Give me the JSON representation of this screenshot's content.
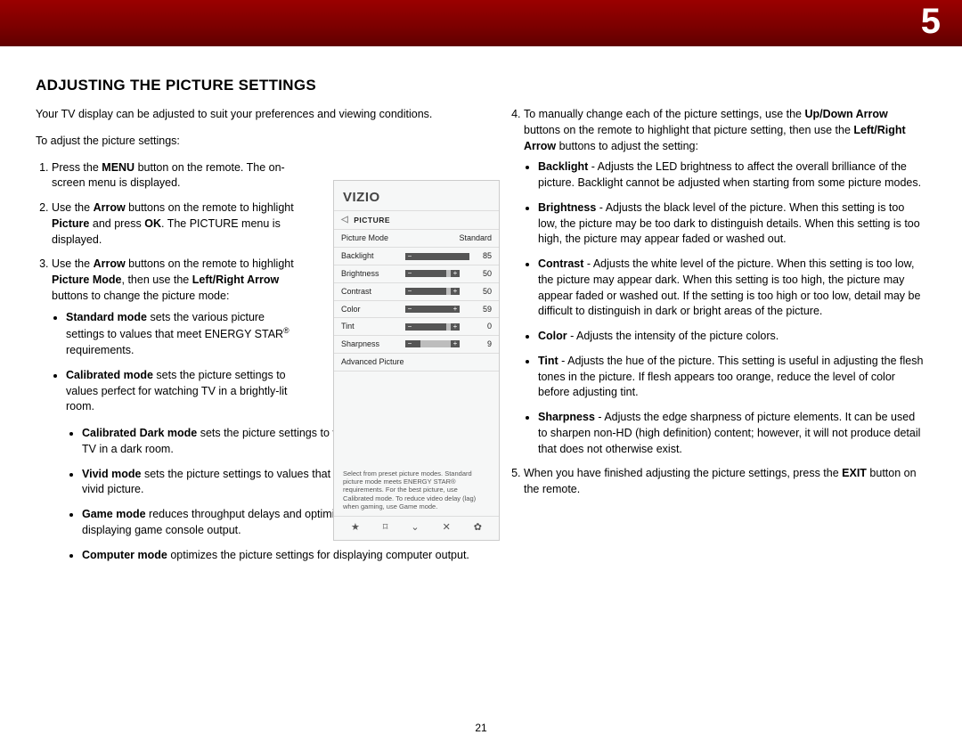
{
  "chapter_number": "5",
  "page_number": "21",
  "heading": "ADJUSTING THE PICTURE SETTINGS",
  "left": {
    "intro": "Your TV display can be adjusted to suit your preferences and viewing conditions.",
    "lead": "To adjust the picture settings:",
    "s1a": "Press the ",
    "s1b": "MENU",
    "s1c": " button on the remote. The on-screen menu is displayed.",
    "s2a": "Use the ",
    "s2b": "Arrow",
    "s2c": " buttons on the remote to highlight ",
    "s2d": "Picture",
    "s2e": " and press ",
    "s2f": "OK",
    "s2g": ". The PICTURE menu is displayed.",
    "s3a": "Use the ",
    "s3b": "Arrow",
    "s3c": " buttons on the remote to highlight ",
    "s3d": "Picture Mode",
    "s3e": ", then use the ",
    "s3f": "Left/Right Arrow",
    "s3g": " buttons to change the picture mode:",
    "m1a": "Standard mode",
    "m1b": " sets the various picture settings to values that meet ENERGY STAR",
    "m1sup": "®",
    "m1c": " requirements.",
    "m2a": "Calibrated mode",
    "m2b": " sets the picture settings to values perfect for watching TV in a brightly-lit room.",
    "m3a": "Calibrated Dark mode",
    "m3b": " sets the picture settings to values perfect for watching TV in a dark room.",
    "m4a": "Vivid mode",
    "m4b": " sets the picture settings to values that produce a brighter, more vivid picture.",
    "m5a": "Game mode",
    "m5b": " reduces throughput delays and optimizes the picture settings for displaying game console output.",
    "m6a": "Computer mode",
    "m6b": " optimizes the picture settings for displaying computer output."
  },
  "right": {
    "s4a": "To manually change each of the picture settings, use the ",
    "s4b": "Up/Down Arrow",
    "s4c": " buttons on the remote to highlight that picture setting, then use the ",
    "s4d": "Left/Right Arrow",
    "s4e": " buttons to adjust the setting:",
    "d1a": "Backlight",
    "d1b": " - Adjusts the LED brightness to affect the overall brilliance of the picture. Backlight cannot be adjusted when starting from some picture modes.",
    "d2a": "Brightness",
    "d2b": " - Adjusts the black level of the picture. When this setting is too low, the picture may be too dark to distinguish details. When this setting is too high, the picture may appear faded or washed out.",
    "d3a": "Contrast",
    "d3b": " - Adjusts the white level of the picture. When this setting is too low, the picture may appear dark. When this setting is too high, the picture may appear faded or washed out. If the setting is too high or too low, detail may be difficult to distinguish in dark or bright areas of the picture.",
    "d4a": "Color",
    "d4b": " - Adjusts the intensity of the picture colors.",
    "d5a": "Tint",
    "d5b": " - Adjusts the hue of the picture. This setting is useful in adjusting the flesh tones in the picture. If flesh appears too orange, reduce the level of color before adjusting tint.",
    "d6a": "Sharpness",
    "d6b": " - Adjusts the edge sharpness of picture elements. It can be used to sharpen non-HD (high definition) content; however, it will not produce detail that does not otherwise exist.",
    "s5a": "When you have finished adjusting the picture settings, press the ",
    "s5b": "EXIT",
    "s5c": " button on the remote."
  },
  "osd": {
    "brand": "VIZIO",
    "title": "PICTURE",
    "rows": [
      {
        "label": "Picture Mode",
        "value": "Standard",
        "slider": false
      },
      {
        "label": "Backlight",
        "value": "85",
        "slider": true,
        "fill": 85
      },
      {
        "label": "Brightness",
        "value": "50",
        "slider": true,
        "fill": 50
      },
      {
        "label": "Contrast",
        "value": "50",
        "slider": true,
        "fill": 50
      },
      {
        "label": "Color",
        "value": "59",
        "slider": true,
        "fill": 59
      },
      {
        "label": "Tint",
        "value": "0",
        "slider": true,
        "fill": 50
      },
      {
        "label": "Sharpness",
        "value": "9",
        "slider": true,
        "fill": 9
      }
    ],
    "advanced": "Advanced Picture",
    "note": "Select from preset picture modes. Standard picture mode meets ENERGY STAR® requirements. For the best picture, use Calibrated mode. To reduce video delay (lag) when gaming, use Game mode.",
    "icons": [
      "★",
      "⌑",
      "⌄",
      "✕",
      "✿"
    ]
  }
}
